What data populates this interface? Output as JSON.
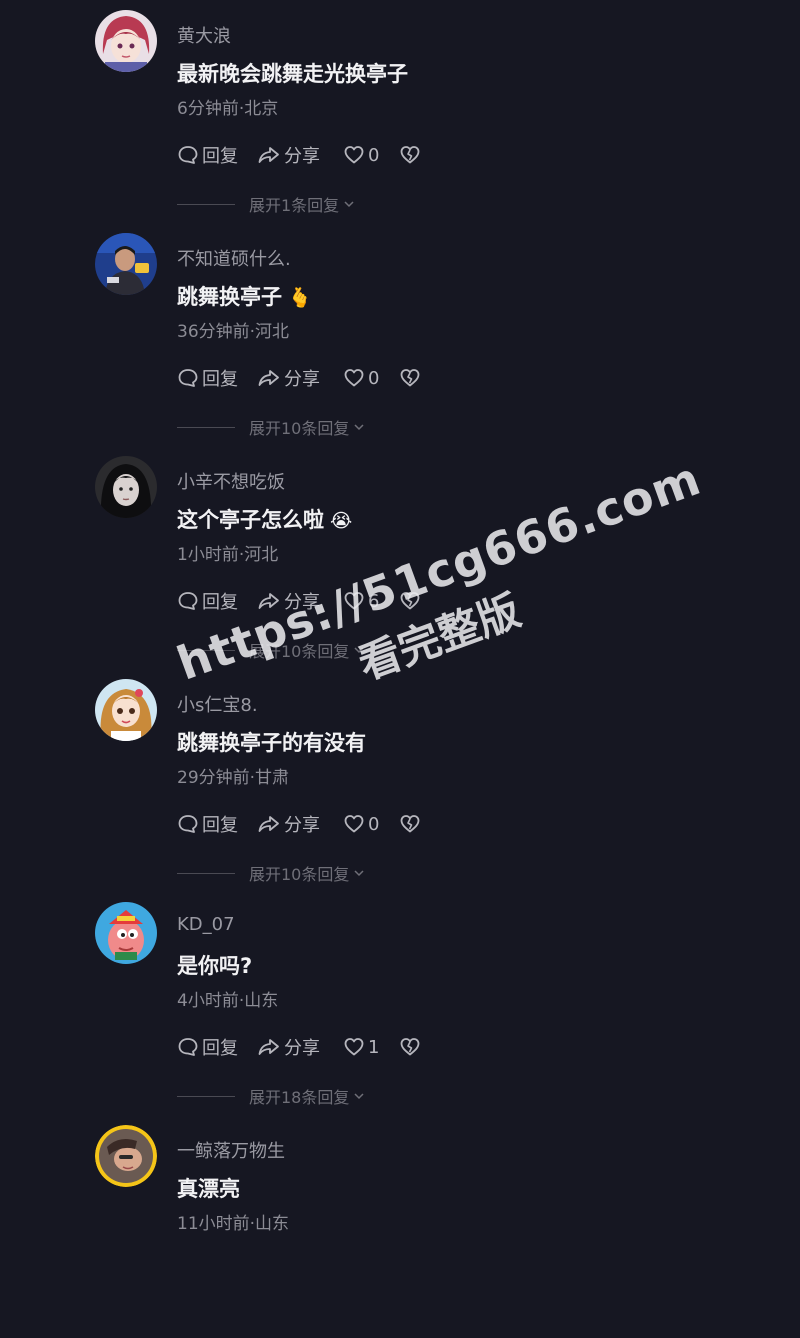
{
  "actions": {
    "reply_label": "回复",
    "share_label": "分享"
  },
  "colors": {
    "background": "#161722",
    "username": "#9a9aa3",
    "comment_text": "#f2f2f4",
    "meta": "#8c8c95",
    "action": "#b6b6bd",
    "expand": "#6f6f78"
  },
  "comments": [
    {
      "username": "黄大浪",
      "text": "最新晚会跳舞走光换亭子",
      "emoji": "",
      "meta": "6分钟前·北京",
      "likes": "0",
      "expand_label": "展开1条回复",
      "avatar_icon": "anime-girl-avatar-icon"
    },
    {
      "username": "不知道硕什么.",
      "text": "跳舞换亭子",
      "emoji": "🫰",
      "meta": "36分钟前·河北",
      "likes": "0",
      "expand_label": "展开10条回复",
      "avatar_icon": "man-photo-avatar-icon"
    },
    {
      "username": "小辛不想吃饭",
      "text": "这个亭子怎么啦",
      "emoji": "😭",
      "meta": "1小时前·河北",
      "likes": "6",
      "expand_label": "展开10条回复",
      "avatar_icon": "dark-portrait-avatar-icon"
    },
    {
      "username": "小s仁宝8.",
      "text": "跳舞换亭子的有没有",
      "emoji": "",
      "meta": "29分钟前·甘肃",
      "likes": "0",
      "expand_label": "展开10条回复",
      "avatar_icon": "cartoon-girl-avatar-icon"
    },
    {
      "username": "KD_07",
      "text": "是你吗?",
      "emoji": "",
      "meta": "4小时前·山东",
      "likes": "1",
      "expand_label": "展开18条回复",
      "avatar_icon": "cartoon-character-avatar-icon"
    },
    {
      "username": "一鲸落万物生",
      "text": "真漂亮",
      "emoji": "",
      "meta": "11小时前·山东",
      "likes": "",
      "expand_label": "",
      "avatar_icon": "yellow-ring-avatar-icon"
    }
  ],
  "watermark": {
    "url": "https://51cg666.com",
    "subtitle": "看完整版"
  }
}
